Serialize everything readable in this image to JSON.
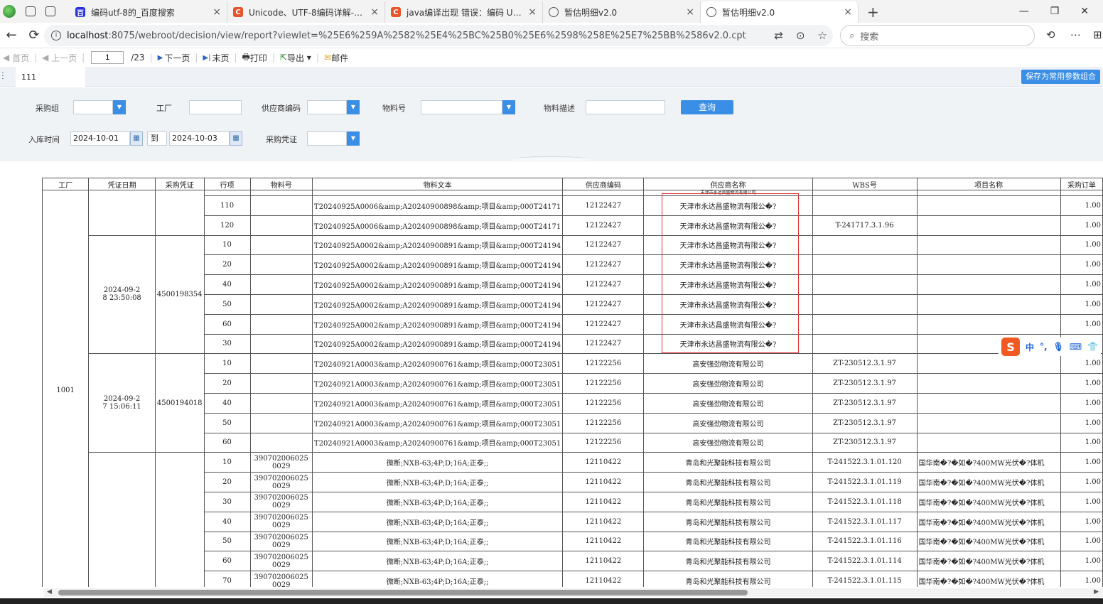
{
  "browser": {
    "tabs": [
      {
        "title": "编码utf-8的_百度搜索",
        "favicon": "baidu"
      },
      {
        "title": "Unicode、UTF-8编码详解-CSDN博",
        "favicon": "csdn"
      },
      {
        "title": "java编译出现 错误：编码 UTF-8 的",
        "favicon": "csdn"
      },
      {
        "title": "暂估明细v2.0",
        "favicon": "globe"
      },
      {
        "title": "暂估明细v2.0",
        "favicon": "globe",
        "active": true
      }
    ],
    "url_host": "localhost",
    "url_rest": ":8075/webroot/decision/view/report?viewlet=%25E6%259A%2582%25E4%25BC%25B0%25E6%2598%258E%25E7%25BB%2586v2.0.cpt",
    "search_placeholder": "搜索"
  },
  "toolbar": {
    "first": "首页",
    "prev": "上一页",
    "page_value": "1",
    "total": "/23",
    "next": "下一页",
    "last": "末页",
    "print": "打印",
    "export": "导出",
    "mail": "邮件"
  },
  "param_tab": {
    "label": "111",
    "save_btn": "保存为常用参数组合"
  },
  "params": {
    "purchase_group": "采购组",
    "factory": "工厂",
    "supplier_code": "供应商编码",
    "material_no": "物料号",
    "material_desc": "物料描述",
    "query": "查询",
    "in_date": "入库时间",
    "date_from": "2024-10-01",
    "to": "到",
    "date_to": "2024-10-03",
    "purchase_doc": "采购凭证"
  },
  "table": {
    "headers": [
      "工厂",
      "凭证日期",
      "采购凭证",
      "行项",
      "物料号",
      "物料文本",
      "供应商编码",
      "供应商名称",
      "WBS号",
      "项目名称",
      "采购订单"
    ],
    "factory": "1001",
    "partial_row": {
      "item": "",
      "text": "",
      "supplier_code": "",
      "supplier_name": "天津市永达昌盛物流有限公司"
    },
    "groups": [
      {
        "date": "",
        "doc": "",
        "rows": [
          {
            "item": "110",
            "mat": "",
            "text": "T20240925A0006&amp;A20240900898&amp;项目&amp;000T24171",
            "code": "12122427",
            "name": "天津市永达昌盛物流有限公�?",
            "wbs": "",
            "proj": "",
            "qty": "1.00"
          },
          {
            "item": "120",
            "mat": "",
            "text": "T20240925A0006&amp;A20240900898&amp;项目&amp;000T24171",
            "code": "12122427",
            "name": "天津市永达昌盛物流有限公�?",
            "wbs": "T-241717.3.1.96",
            "proj": "",
            "qty": "1.00"
          }
        ]
      },
      {
        "date": "2024-09-28 23:50:08",
        "doc": "4500198354",
        "rows": [
          {
            "item": "10",
            "mat": "",
            "text": "T20240925A0002&amp;A20240900891&amp;项目&amp;000T24194",
            "code": "12122427",
            "name": "天津市永达昌盛物流有限公�?",
            "wbs": "",
            "proj": "",
            "qty": "1.00"
          },
          {
            "item": "20",
            "mat": "",
            "text": "T20240925A0002&amp;A20240900891&amp;项目&amp;000T24194",
            "code": "12122427",
            "name": "天津市永达昌盛物流有限公�?",
            "wbs": "",
            "proj": "",
            "qty": "1.00"
          },
          {
            "item": "40",
            "mat": "",
            "text": "T20240925A0002&amp;A20240900891&amp;项目&amp;000T24194",
            "code": "12122427",
            "name": "天津市永达昌盛物流有限公�?",
            "wbs": "",
            "proj": "",
            "qty": "1.00"
          },
          {
            "item": "50",
            "mat": "",
            "text": "T20240925A0002&amp;A20240900891&amp;项目&amp;000T24194",
            "code": "12122427",
            "name": "天津市永达昌盛物流有限公�?",
            "wbs": "",
            "proj": "",
            "qty": "1.00"
          },
          {
            "item": "60",
            "mat": "",
            "text": "T20240925A0002&amp;A20240900891&amp;项目&amp;000T24194",
            "code": "12122427",
            "name": "天津市永达昌盛物流有限公�?",
            "wbs": "",
            "proj": "",
            "qty": "1.00"
          },
          {
            "item": "30",
            "mat": "",
            "text": "T20240925A0002&amp;A20240900891&amp;项目&amp;000T24194",
            "code": "12122427",
            "name": "天津市永达昌盛物流有限公�?",
            "wbs": "",
            "proj": "",
            "qty": "1.00"
          }
        ]
      },
      {
        "date": "2024-09-27 15:06:11",
        "doc": "4500194018",
        "rows": [
          {
            "item": "10",
            "mat": "",
            "text": "T20240921A0003&amp;A20240900761&amp;项目&amp;000T23051",
            "code": "12122256",
            "name": "高安强劲物流有限公司",
            "wbs": "ZT-230512.3.1.97",
            "proj": "",
            "qty": "1.00"
          },
          {
            "item": "20",
            "mat": "",
            "text": "T20240921A0003&amp;A20240900761&amp;项目&amp;000T23051",
            "code": "12122256",
            "name": "高安强劲物流有限公司",
            "wbs": "ZT-230512.3.1.97",
            "proj": "",
            "qty": "1.00"
          },
          {
            "item": "40",
            "mat": "",
            "text": "T20240921A0003&amp;A20240900761&amp;项目&amp;000T23051",
            "code": "12122256",
            "name": "高安强劲物流有限公司",
            "wbs": "ZT-230512.3.1.97",
            "proj": "",
            "qty": "1.00"
          },
          {
            "item": "50",
            "mat": "",
            "text": "T20240921A0003&amp;A20240900761&amp;项目&amp;000T23051",
            "code": "12122256",
            "name": "高安强劲物流有限公司",
            "wbs": "ZT-230512.3.1.97",
            "proj": "",
            "qty": "1.00"
          },
          {
            "item": "60",
            "mat": "",
            "text": "T20240921A0003&amp;A20240900761&amp;项目&amp;000T23051",
            "code": "12122256",
            "name": "高安强劲物流有限公司",
            "wbs": "ZT-230512.3.1.97",
            "proj": "",
            "qty": "1.00"
          }
        ]
      },
      {
        "date": "",
        "doc": "",
        "rows": [
          {
            "item": "10",
            "mat": "3907020060250029",
            "text": "微断;NXB-63;4P;D;16A;正泰;;",
            "code": "12110422",
            "name": "青岛和光聚能科技有限公司",
            "wbs": "T-241522.3.1.01.120",
            "proj": "国华南�?�如�?400MW光伏�?体机",
            "qty": "1.00"
          },
          {
            "item": "20",
            "mat": "3907020060250029",
            "text": "微断;NXB-63;4P;D;16A;正泰;;",
            "code": "12110422",
            "name": "青岛和光聚能科技有限公司",
            "wbs": "T-241522.3.1.01.119",
            "proj": "国华南�?�如�?400MW光伏�?体机",
            "qty": "1.00"
          },
          {
            "item": "30",
            "mat": "3907020060250029",
            "text": "微断;NXB-63;4P;D;16A;正泰;;",
            "code": "12110422",
            "name": "青岛和光聚能科技有限公司",
            "wbs": "T-241522.3.1.01.118",
            "proj": "国华南�?�如�?400MW光伏�?体机",
            "qty": "1.00"
          },
          {
            "item": "40",
            "mat": "3907020060250029",
            "text": "微断;NXB-63;4P;D;16A;正泰;;",
            "code": "12110422",
            "name": "青岛和光聚能科技有限公司",
            "wbs": "T-241522.3.1.01.117",
            "proj": "国华南�?�如�?400MW光伏�?体机",
            "qty": "1.00"
          },
          {
            "item": "50",
            "mat": "3907020060250029",
            "text": "微断;NXB-63;4P;D;16A;正泰;;",
            "code": "12110422",
            "name": "青岛和光聚能科技有限公司",
            "wbs": "T-241522.3.1.01.116",
            "proj": "国华南�?�如�?400MW光伏�?体机",
            "qty": "1.00"
          },
          {
            "item": "60",
            "mat": "3907020060250029",
            "text": "微断;NXB-63;4P;D;16A;正泰;;",
            "code": "12110422",
            "name": "青岛和光聚能科技有限公司",
            "wbs": "T-241522.3.1.01.114",
            "proj": "国华南�?�如�?400MW光伏�?体机",
            "qty": "1.00"
          },
          {
            "item": "70",
            "mat": "3907020060250029",
            "text": "微断;NXB-63;4P;D;16A;正泰;;",
            "code": "12110422",
            "name": "青岛和光聚能科技有限公司",
            "wbs": "T-241522.3.1.01.115",
            "proj": "国华南�?�如�?400MW光伏�?体机",
            "qty": "1.00"
          }
        ]
      }
    ]
  },
  "ime": {
    "logo": "S",
    "lang": "中",
    "punct": "°,"
  },
  "colors": {
    "accent": "#3a8ee6",
    "highlight_box": "#e03030"
  }
}
